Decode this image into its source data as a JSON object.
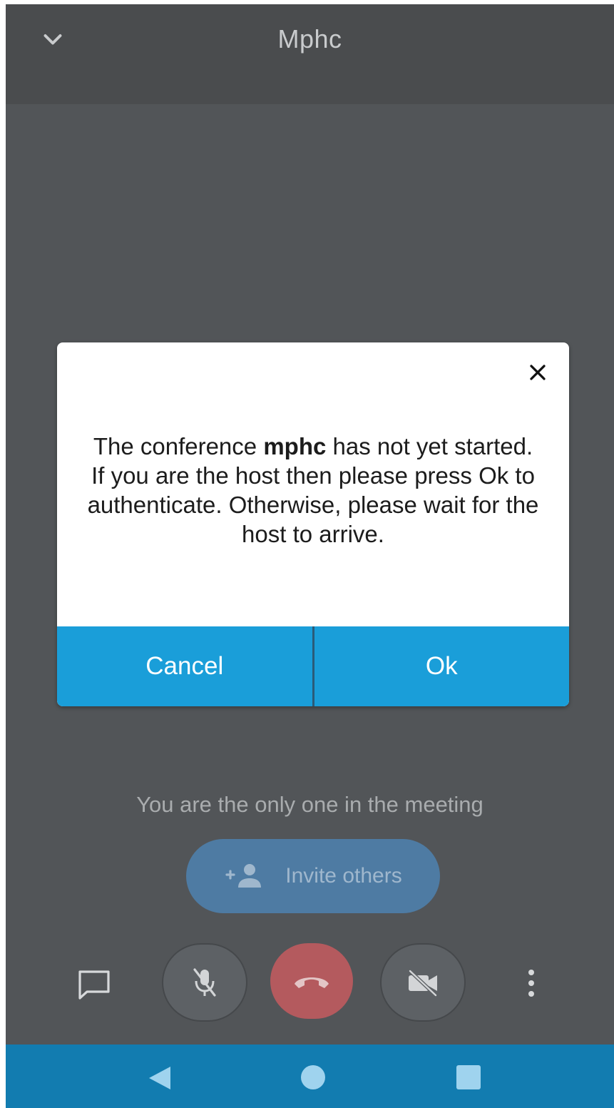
{
  "header": {
    "title": "Mphc",
    "collapse_icon": "chevron-down-icon"
  },
  "dialog": {
    "message_before": "The conference ",
    "room_name": "mphc",
    "message_after": " has not yet started. If you are the host then please press Ok to authenticate. Otherwise, please wait for the host to arrive.",
    "cancel_label": "Cancel",
    "ok_label": "Ok",
    "accent_color": "#1a9ed9"
  },
  "meeting": {
    "status_text": "You are the only one in the meeting",
    "invite_label": "Invite others"
  },
  "toolbar": {
    "icons": [
      "chat-icon",
      "mic-off-icon",
      "hangup-icon",
      "video-off-icon",
      "more-vertical-icon"
    ],
    "hangup_color": "#b45a5e"
  },
  "system_nav": {
    "icons": [
      "back-icon",
      "home-icon",
      "recents-icon"
    ],
    "color": "#127cb0"
  }
}
